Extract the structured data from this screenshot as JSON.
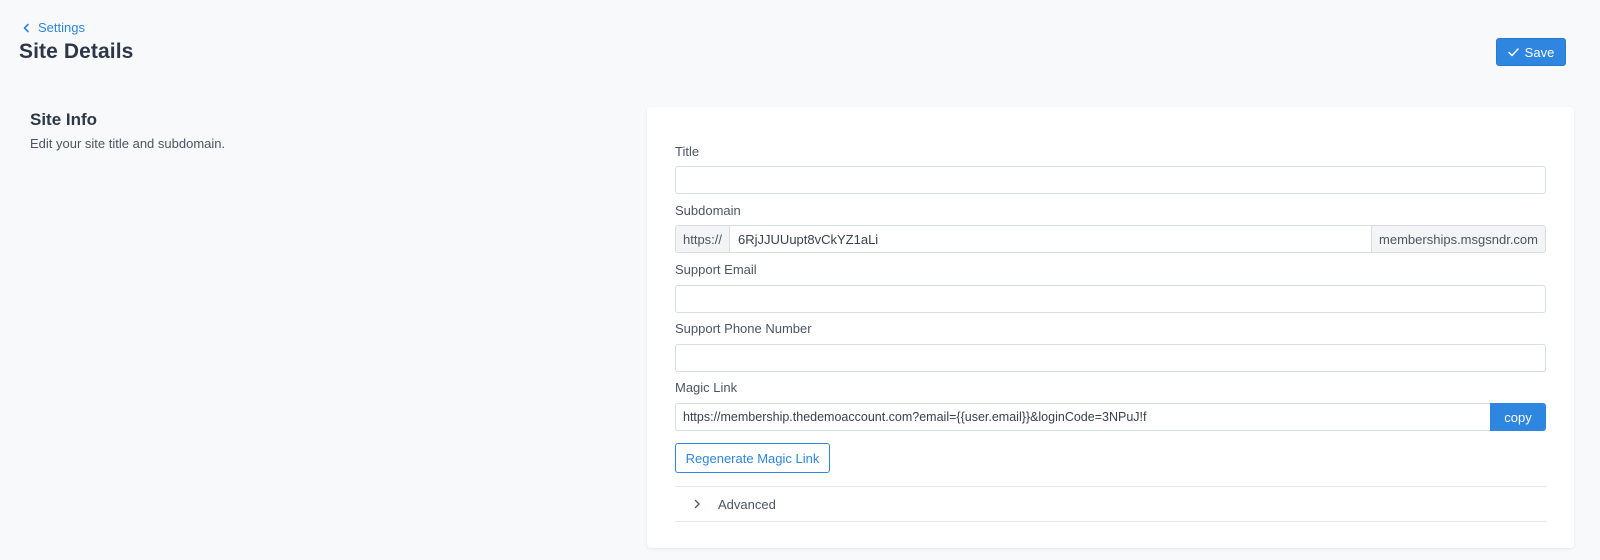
{
  "header": {
    "back_label": "Settings",
    "title": "Site Details",
    "save_label": "Save"
  },
  "section": {
    "title": "Site Info",
    "description": "Edit your site title and subdomain."
  },
  "form": {
    "title": {
      "label": "Title",
      "value": ""
    },
    "subdomain": {
      "label": "Subdomain",
      "prefix": "https://",
      "value": "6RjJJUUupt8vCkYZ1aLi",
      "suffix": "memberships.msgsndr.com"
    },
    "support_email": {
      "label": "Support Email",
      "value": ""
    },
    "support_phone": {
      "label": "Support Phone Number",
      "value": ""
    },
    "magic_link": {
      "label": "Magic Link",
      "value": "https://membership.thedemoaccount.com?email={{user.email}}&loginCode=3NPuJ!f",
      "copy_label": "copy",
      "regenerate_label": "Regenerate Magic Link"
    },
    "advanced_label": "Advanced"
  },
  "icons": {
    "back": "chevron-left-icon",
    "save": "check-icon",
    "advanced": "chevron-right-icon"
  },
  "colors": {
    "accent": "#2f86e0",
    "background": "#f8f9fb",
    "card": "#ffffff",
    "text": "#374151"
  }
}
